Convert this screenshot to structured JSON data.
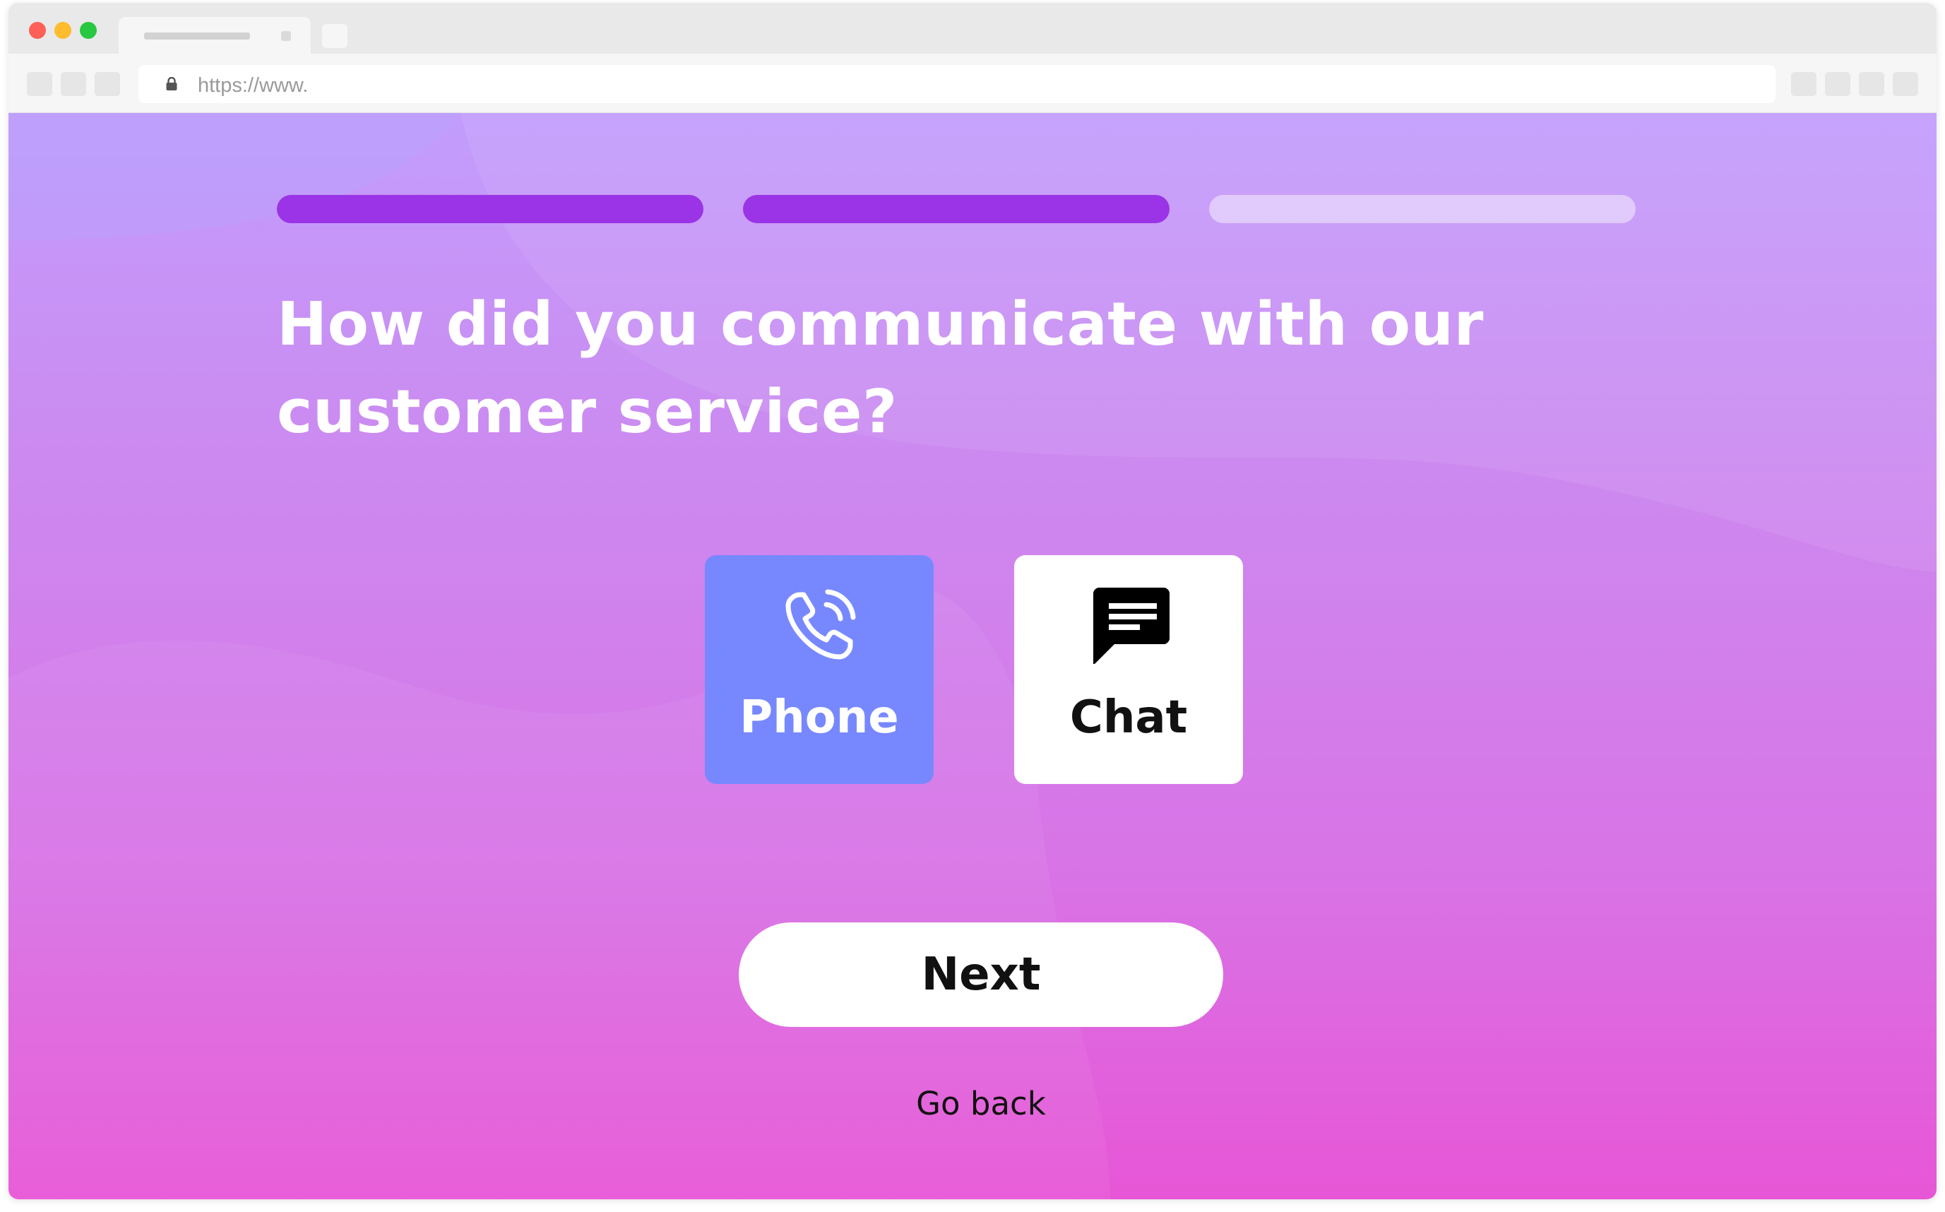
{
  "browser": {
    "url": "https://www.",
    "icons": {
      "lock": "lock-icon",
      "back": "back-icon",
      "forward": "forward-icon",
      "reload": "reload-icon"
    }
  },
  "survey": {
    "progress": {
      "current_step": 2,
      "total_steps": 3
    },
    "question": "How did you communicate with our customer service?",
    "options": [
      {
        "label": "Phone",
        "icon": "phone-icon",
        "selected": true
      },
      {
        "label": "Chat",
        "icon": "chat-bubble-icon",
        "selected": false
      }
    ],
    "next_label": "Next",
    "back_label": "Go back"
  },
  "colors": {
    "progress_active": "#9a34e6",
    "selected_option": "#7788ff",
    "gradient_top": "#c29dfc",
    "gradient_bottom": "#e756d6"
  }
}
